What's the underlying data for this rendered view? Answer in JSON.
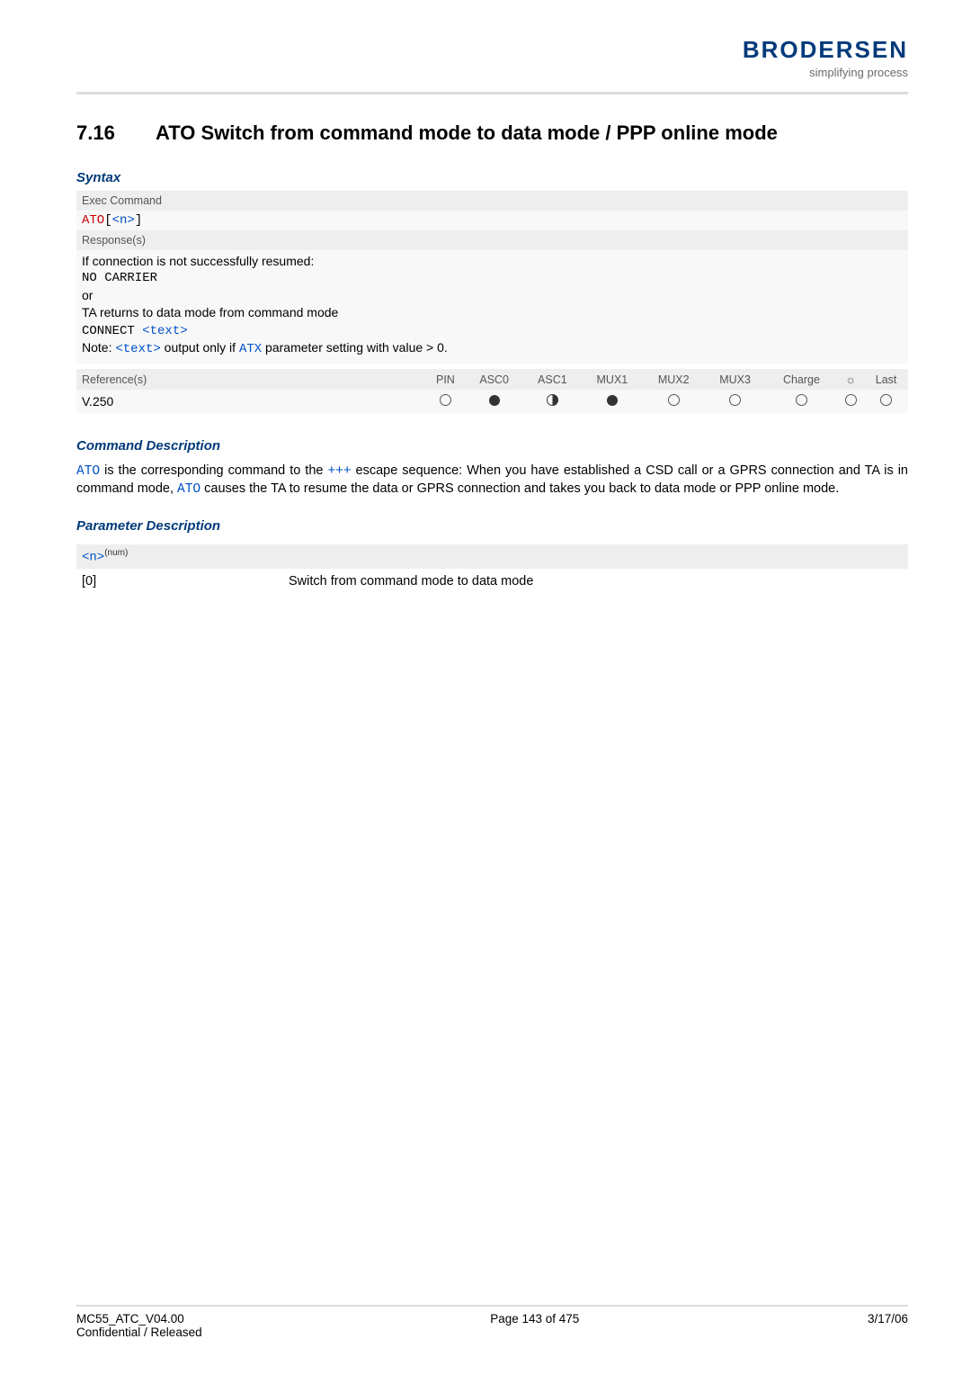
{
  "header": {
    "logo": "BRODERSEN",
    "tagline": "simplifying process"
  },
  "section": {
    "number": "7.16",
    "title": "ATO   Switch from command mode to data mode / PPP online mode"
  },
  "syntax": {
    "heading": "Syntax",
    "exec_label": "Exec Command",
    "cmd_prefix": "ATO",
    "cmd_param": "<n>",
    "responses_label": "Response(s)",
    "resp_line1": "If connection is not successfully resumed:",
    "resp_line2": "NO CARRIER",
    "resp_line3": "or",
    "resp_line4": "TA returns to data mode from command mode",
    "resp_line5a": "CONNECT ",
    "resp_line5b": "<text>",
    "resp_line6a": "Note: ",
    "resp_line6b": "<text>",
    "resp_line6c": " output only if ",
    "resp_line6d": "ATX",
    "resp_line6e": " parameter setting with value > 0."
  },
  "ref_table": {
    "headers": [
      "Reference(s)",
      "PIN",
      "ASC0",
      "ASC1",
      "MUX1",
      "MUX2",
      "MUX3",
      "Charge",
      "",
      "Last"
    ],
    "row": {
      "ref": "V.250",
      "cells": [
        "empty",
        "full",
        "half",
        "full",
        "empty",
        "empty",
        "empty",
        "empty",
        "empty"
      ]
    }
  },
  "cmd_desc": {
    "heading": "Command Description",
    "t1": "ATO",
    "t2": " is the corresponding command to the ",
    "t3": "+++",
    "t4": " escape sequence: When you have established a CSD call or a GPRS connection and TA is in command mode, ",
    "t5": "ATO",
    "t6": " causes the TA to resume the data or GPRS connection and takes you back to data mode or PPP online mode."
  },
  "param_desc": {
    "heading": "Parameter Description",
    "name": "<n>",
    "sup": "(num)",
    "key": "[0]",
    "val": "Switch from command mode to data mode"
  },
  "footer": {
    "left1": "MC55_ATC_V04.00",
    "left2": "Confidential / Released",
    "center": "Page 143 of 475",
    "right": "3/17/06"
  }
}
